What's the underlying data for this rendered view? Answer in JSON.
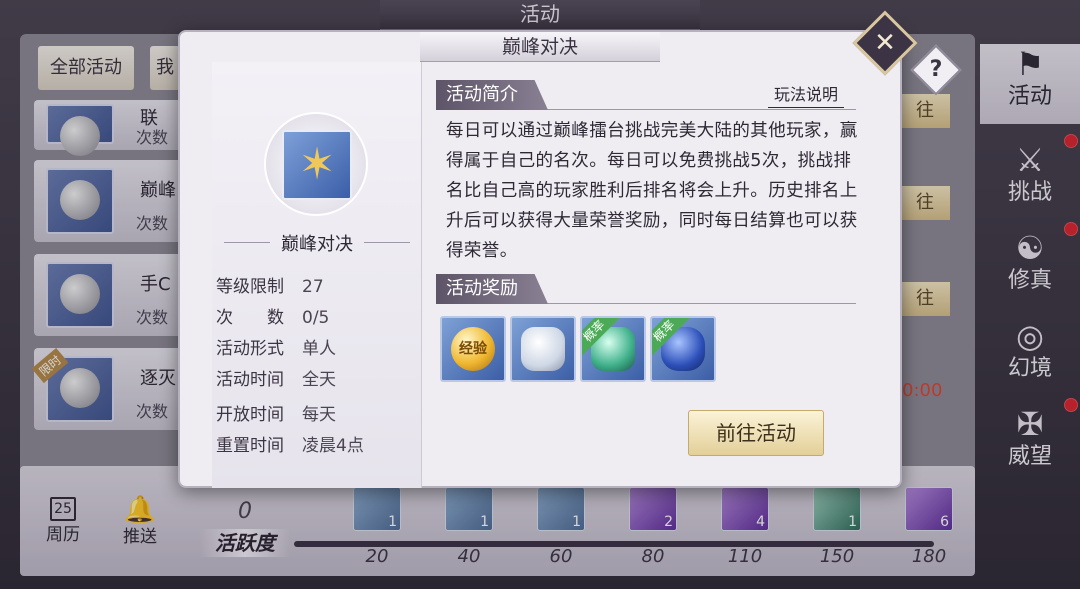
{
  "screen_title": "活动",
  "background": {
    "tabs": [
      "全部活动",
      "我"
    ],
    "rows": [
      {
        "name": "联",
        "count_label": "次数"
      },
      {
        "name": "巅峰",
        "count_label": "次数"
      },
      {
        "name": "手C",
        "count_label": "次数"
      },
      {
        "name": "逐灭",
        "count_label": "次数",
        "limited_tag": "限时"
      }
    ],
    "go_label": "往",
    "timer": "0:00"
  },
  "sidebar": {
    "items": [
      {
        "label": "活动",
        "icon": "flag-icon",
        "glyph": "⚑",
        "active": true,
        "badge": false
      },
      {
        "label": "挑战",
        "icon": "crossed-weapons-icon",
        "glyph": "⚔",
        "active": false,
        "badge": true
      },
      {
        "label": "修真",
        "icon": "swirl-icon",
        "glyph": "☯",
        "active": false,
        "badge": true
      },
      {
        "label": "幻境",
        "icon": "spiral-icon",
        "glyph": "◎",
        "active": false,
        "badge": false
      },
      {
        "label": "威望",
        "icon": "wings-icon",
        "glyph": "✠",
        "active": false,
        "badge": true
      }
    ]
  },
  "bottom": {
    "calendar": {
      "label": "周历",
      "day": "25",
      "icon": "calendar-icon"
    },
    "push": {
      "label": "推送",
      "icon": "bell-icon"
    },
    "activity_score": {
      "value": "0",
      "label": "活跃度"
    },
    "progress_fraction": 0,
    "chests": [
      {
        "milestone": "20",
        "count": "1",
        "style": "blue"
      },
      {
        "milestone": "40",
        "count": "1",
        "style": "blue"
      },
      {
        "milestone": "60",
        "count": "1",
        "style": "blue"
      },
      {
        "milestone": "80",
        "count": "2",
        "style": "purple"
      },
      {
        "milestone": "110",
        "count": "4",
        "style": "purple"
      },
      {
        "milestone": "150",
        "count": "1",
        "style": "green"
      },
      {
        "milestone": "180",
        "count": "6",
        "style": "purple"
      }
    ]
  },
  "modal": {
    "title": "巅峰对决",
    "activity_name": "巅峰对决",
    "badge_icon": "star-shield-icon",
    "info": [
      {
        "key": "等级限制",
        "value": "27"
      },
      {
        "key": "次　　数",
        "value": "0/5"
      },
      {
        "key": "活动形式",
        "value": "单人"
      },
      {
        "key": "活动时间",
        "value": "全天"
      },
      {
        "key": "开放时间",
        "value": "每天"
      },
      {
        "key": "重置时间",
        "value": "凌晨4点"
      }
    ],
    "intro_heading": "活动简介",
    "rules_link": "玩法说明",
    "intro_text": "每日可以通过巅峰擂台挑战完美大陆的其他玩家，赢得属于自己的名次。每日可以免费挑战5次，挑战排名比自己高的玩家胜利后排名将会上升。历史排名上升后可以获得大量荣誉奖励，同时每日结算也可以获得荣誉。",
    "reward_heading": "活动奖励",
    "rewards": [
      {
        "name": "exp-orb",
        "label": "经验",
        "corner": "",
        "color": "#f0b832"
      },
      {
        "name": "silver-gem",
        "label": "",
        "corner": "",
        "color": "#e6ecf4"
      },
      {
        "name": "green-gem",
        "label": "",
        "corner": "概率",
        "color": "#3fb08a"
      },
      {
        "name": "blue-gem",
        "label": "",
        "corner": "概率",
        "color": "#2c4fb8"
      }
    ],
    "goto_label": "前往活动",
    "close_glyph": "✕",
    "help_glyph": "?"
  },
  "colors": {
    "accent_gold": "#d9b455",
    "badge_red": "#d9252f",
    "section_tag": "#5e5468"
  }
}
